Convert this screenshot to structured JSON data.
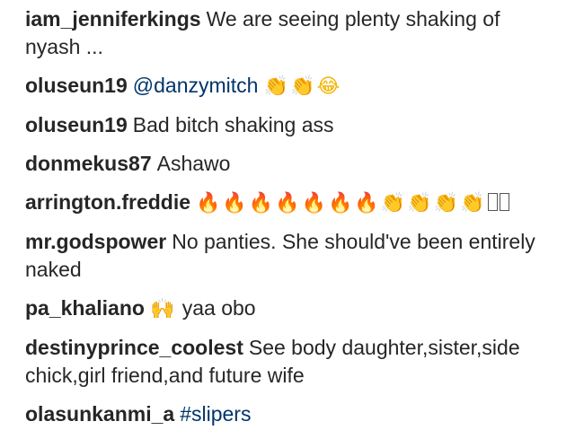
{
  "comments": [
    {
      "user": "iam_jenniferkings",
      "text": "We are seeing plenty shaking of nyash ..."
    },
    {
      "user": "oluseun19",
      "mention": "@danzymitch",
      "emoji": "👏👏😂"
    },
    {
      "user": "oluseun19",
      "text": "Bad bitch shaking ass"
    },
    {
      "user": "donmekus87",
      "text": "Ashawo"
    },
    {
      "user": "arrington.freddie",
      "fire": "🔥🔥🔥🔥🔥🔥🔥",
      "claps": "👏👏👏👏"
    },
    {
      "user": "mr.godspower",
      "text": "No panties. She should've been entirely naked"
    },
    {
      "user": "pa_khaliano",
      "emoji": "🙌",
      "text": "yaa obo"
    },
    {
      "user": "destinyprince_coolest",
      "text": "See body daughter,sister,side chick,girl friend,and future wife"
    },
    {
      "user": "olasunkanmi_a",
      "tag": "#slipers"
    }
  ],
  "colors": {
    "username": "#262626",
    "mention": "#003569",
    "text": "#262626"
  },
  "icons": [
    "clapping-hands-emoji",
    "tears-of-joy-emoji",
    "fire-emoji",
    "raising-hands-emoji",
    "missing-glyph-box"
  ]
}
